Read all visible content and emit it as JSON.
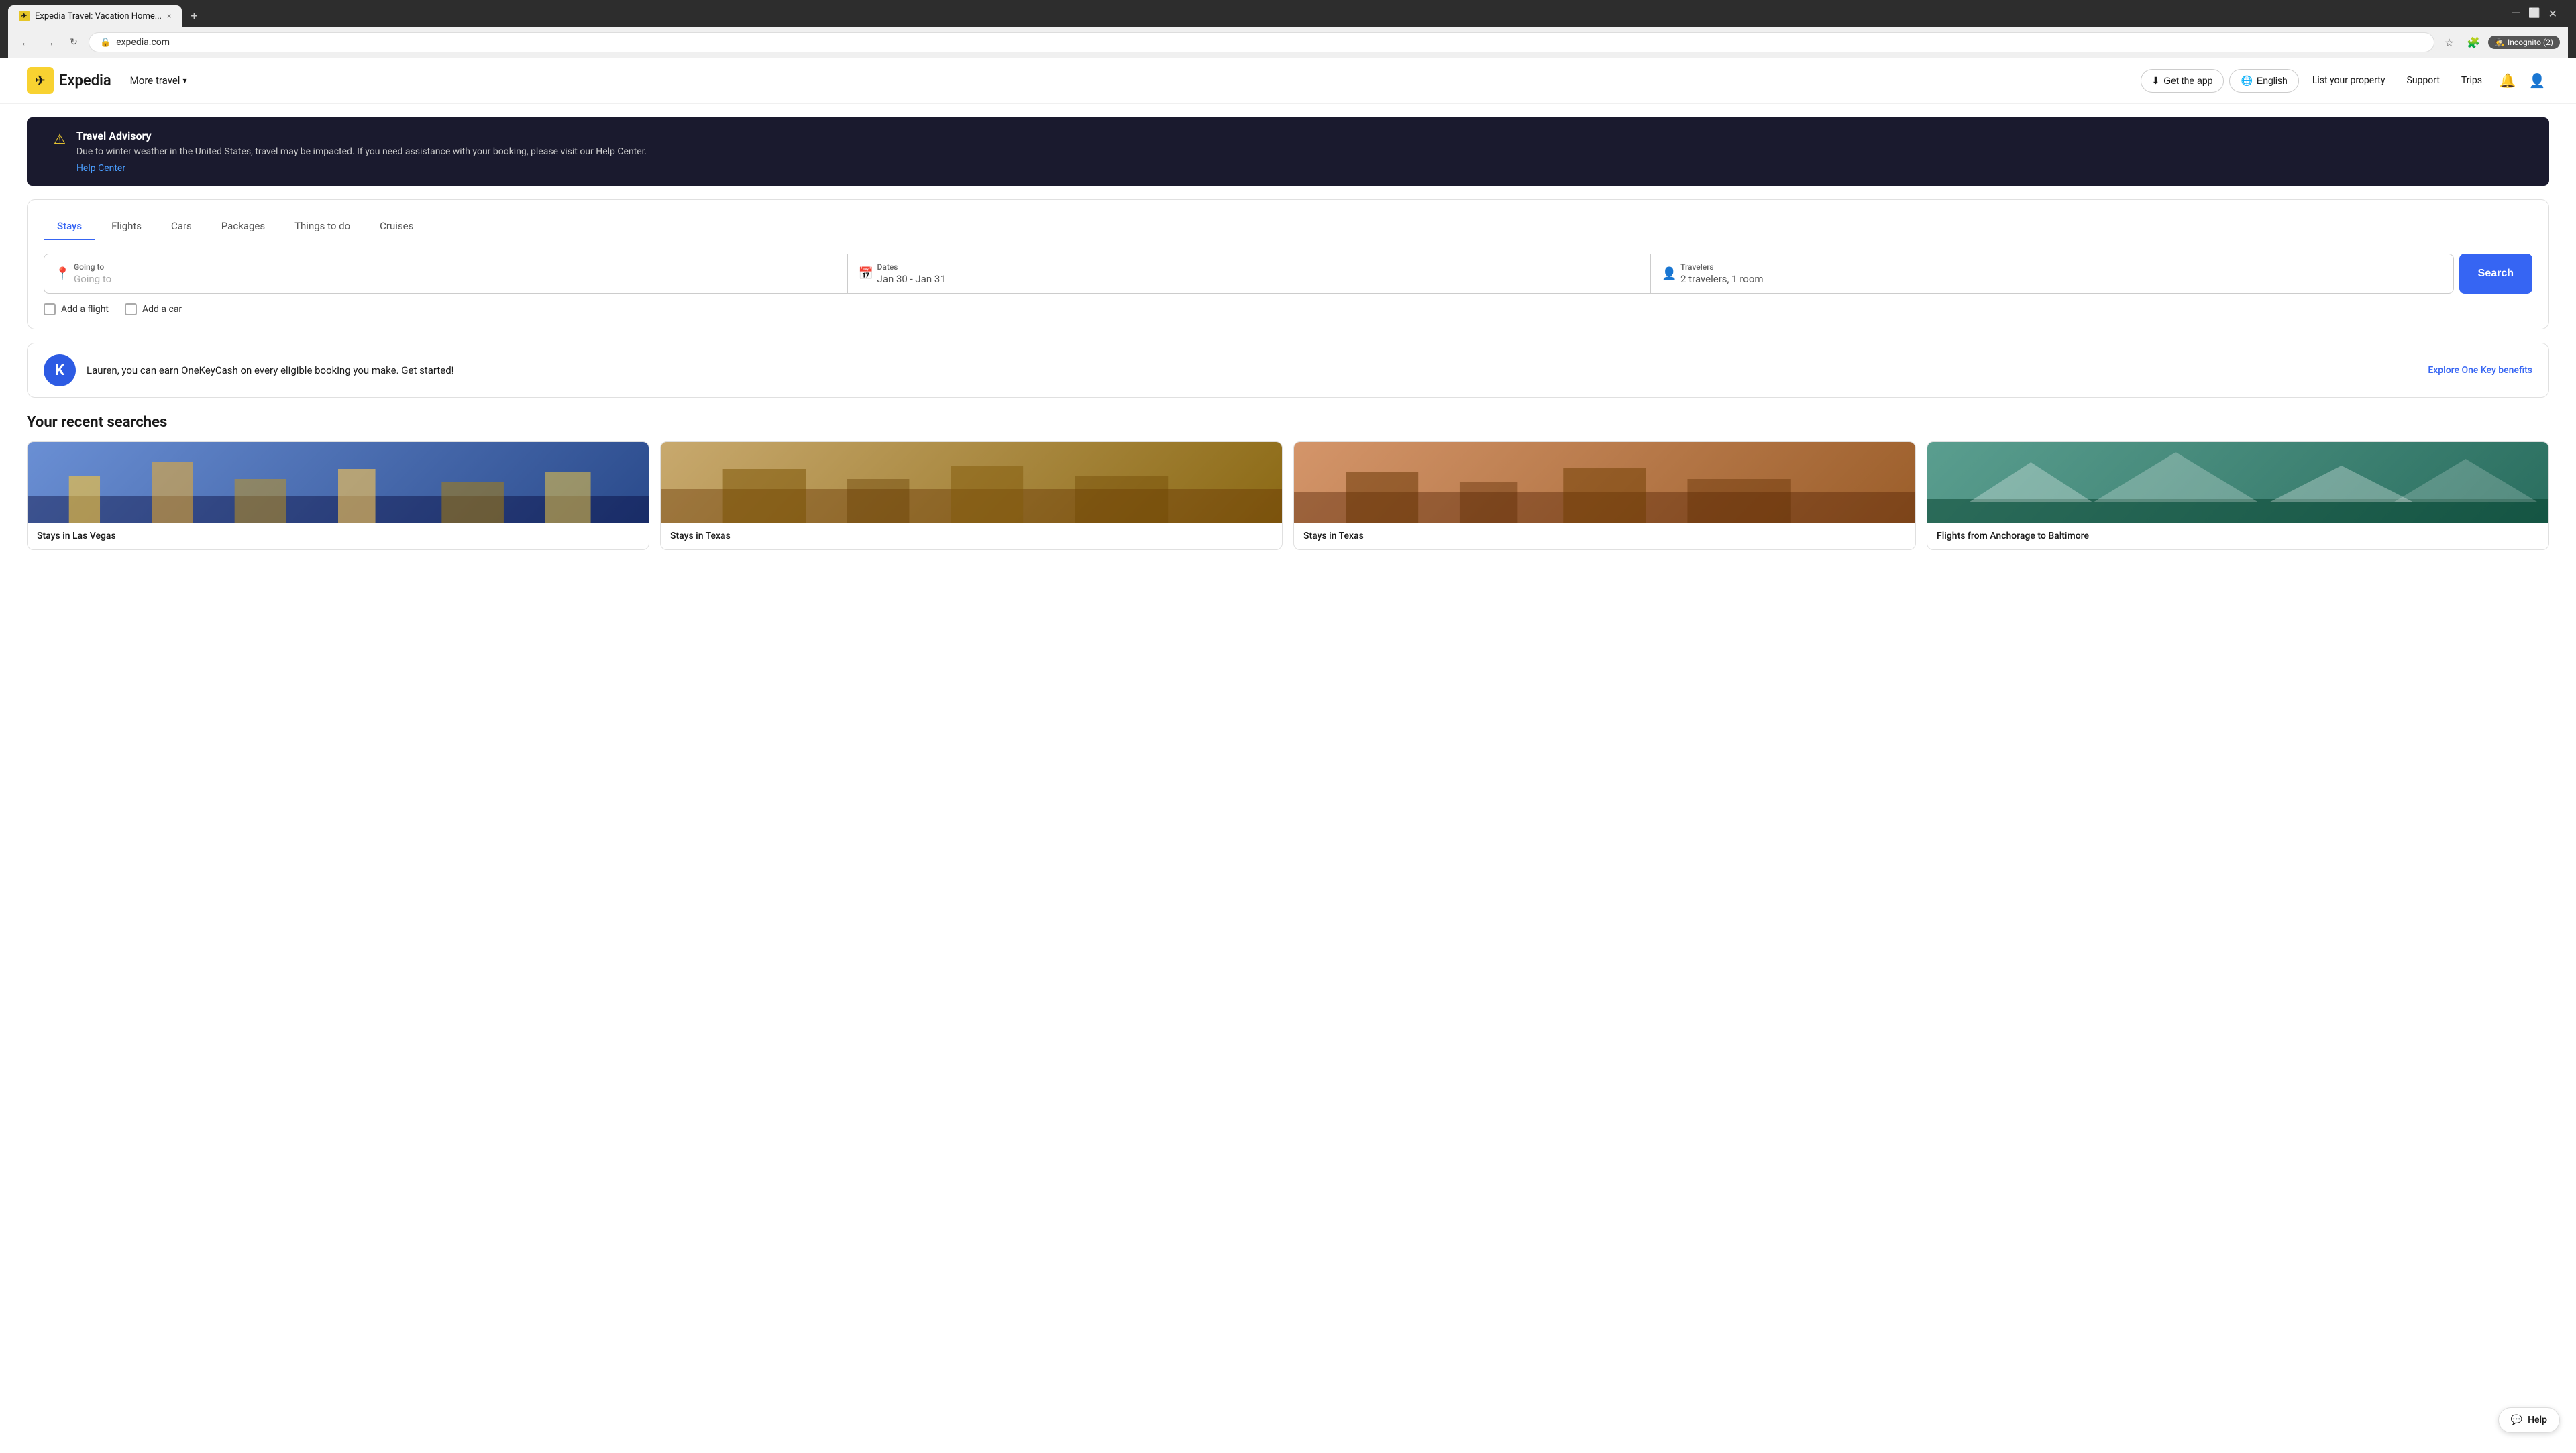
{
  "browser": {
    "tab_title": "Expedia Travel: Vacation Home...",
    "tab_close": "×",
    "tab_new": "+",
    "url": "expedia.com",
    "nav": {
      "back": "←",
      "forward": "→",
      "refresh": "↻"
    },
    "incognito_label": "Incognito (2)",
    "window_controls": [
      "—",
      "⬜",
      "✕"
    ]
  },
  "header": {
    "logo_letter": "✈",
    "logo_text": "Expedia",
    "more_travel": "More travel",
    "more_travel_chevron": "▾",
    "get_app": "Get the app",
    "get_app_icon": "⬇",
    "language": "English",
    "language_icon": "🌐",
    "list_property": "List your property",
    "support": "Support",
    "trips": "Trips",
    "notification_icon": "🔔",
    "user_icon": "👤"
  },
  "advisory": {
    "icon": "⚠",
    "title": "Travel Advisory",
    "text": "Due to winter weather in the United States, travel may be impacted. If you need assistance with your booking, please visit our Help Center.",
    "link": "Help Center"
  },
  "search_widget": {
    "tabs": [
      {
        "label": "Stays",
        "active": true
      },
      {
        "label": "Flights",
        "active": false
      },
      {
        "label": "Cars",
        "active": false
      },
      {
        "label": "Packages",
        "active": false
      },
      {
        "label": "Things to do",
        "active": false
      },
      {
        "label": "Cruises",
        "active": false
      }
    ],
    "going_to": {
      "icon": "📍",
      "label": "Going to",
      "placeholder": "Going to"
    },
    "dates": {
      "icon": "📅",
      "label": "Dates",
      "value": "Jan 30 - Jan 31"
    },
    "travelers": {
      "icon": "👤",
      "label": "Travelers",
      "value": "2 travelers, 1 room"
    },
    "search_btn": "Search",
    "add_flight": "Add a flight",
    "add_car": "Add a car"
  },
  "onekey": {
    "avatar_letter": "K",
    "text": "Lauren, you can earn OneKeyCash on every eligible booking you make. Get started!",
    "link": "Explore One Key benefits"
  },
  "recent_searches": {
    "title": "Your recent searches",
    "cards": [
      {
        "label": "Stays in Las Vegas",
        "style": "vegas"
      },
      {
        "label": "Stays in Texas",
        "style": "texas1"
      },
      {
        "label": "Stays in Texas",
        "style": "texas2"
      },
      {
        "label": "Flights from Anchorage to Baltimore",
        "style": "anchorage"
      }
    ]
  },
  "help": {
    "icon": "💬",
    "label": "Help"
  }
}
